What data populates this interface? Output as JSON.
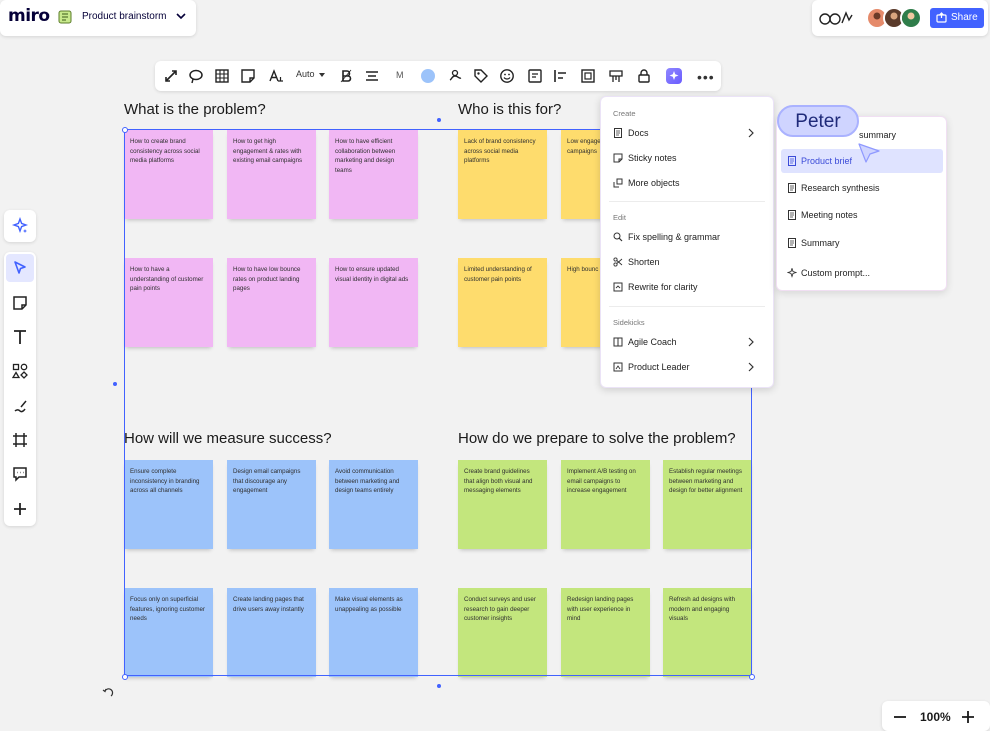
{
  "app": {
    "logo_text": "miro",
    "board_name": "Product brainstorm"
  },
  "header_right": {
    "share_label": "Share",
    "avatar_colors": [
      "#e58a6a",
      "#5a3a2a",
      "#2f7d4a"
    ]
  },
  "context_toolbar": {
    "font_size_label": "Auto",
    "size_label": "M",
    "selected_color": "#9cc3fa",
    "icons": [
      "connection-line-icon",
      "lasso-icon",
      "table-icon",
      "sticky-note-icon",
      "text-format-icon",
      "bold-icon",
      "align-center-icon",
      "fill-color-icon",
      "brush-icon",
      "tag-icon",
      "emoji-icon",
      "card-icon",
      "align-left-icon",
      "frame-icon",
      "grid-icon",
      "lock-icon",
      "ai-sparkle-icon",
      "more-icon"
    ]
  },
  "left_toolbar": {
    "tools": [
      "ai-sparkle-icon",
      "select-cursor-icon",
      "sticky-note-icon",
      "text-icon",
      "shapes-icon",
      "pen-icon",
      "frame-icon",
      "comment-icon",
      "add-icon"
    ]
  },
  "board": {
    "sections": [
      {
        "title": "What is the problem?",
        "color": "pink",
        "notes": [
          "How to create brand consistency across social media platforms",
          "How to get high engagement & rates with existing email campaigns",
          "How to have efficient collaboration between marketing and design teams",
          "How to have a understanding of customer pain points",
          "How to have low bounce rates on product landing pages",
          "How to ensure updated visual identity in digital ads"
        ]
      },
      {
        "title": "Who is this for?",
        "color": "yellow",
        "notes": [
          "Lack of brand consistency across social media platforms",
          "Low engage with existi campaigns",
          "Limited understanding of customer pain points",
          "High bounc product lan"
        ]
      },
      {
        "title": "How will we measure success?",
        "color": "blue",
        "notes": [
          "Ensure complete inconsistency in branding across all channels",
          "Design email campaigns that discourage any engagement",
          "Avoid communication between marketing and design teams entirely",
          "Focus only on superficial features, ignoring customer needs",
          "Create landing pages that drive users away instantly",
          "Make visual elements as unappealing as possible"
        ]
      },
      {
        "title": "How do we prepare to solve the problem?",
        "color": "green",
        "notes": [
          "Create brand guidelines that align both visual and messaging elements",
          "Implement A/B testing on email campaigns to increase engagement",
          "Establish regular meetings between marketing and design for better alignment",
          "Conduct surveys and user research to gain deeper customer insights",
          "Redesign landing pages with user experience in mind",
          "Refresh ad designs with modern and engaging visuals"
        ]
      }
    ]
  },
  "ai_menu": {
    "create_header": "Create",
    "create_items": [
      {
        "label": "Docs",
        "icon": "doc-icon",
        "submenu": true
      },
      {
        "label": "Sticky notes",
        "icon": "sticky-note-icon",
        "submenu": false
      },
      {
        "label": "More objects",
        "icon": "more-objects-icon",
        "submenu": false
      }
    ],
    "edit_header": "Edit",
    "edit_items": [
      {
        "label": "Fix spelling & grammar",
        "icon": "spellcheck-icon"
      },
      {
        "label": "Shorten",
        "icon": "scissors-icon"
      },
      {
        "label": "Rewrite for clarity",
        "icon": "rewrite-icon"
      }
    ],
    "sidekicks_header": "Sidekicks",
    "sidekick_items": [
      {
        "label": "Agile Coach",
        "icon": "agile-coach-icon",
        "submenu": true
      },
      {
        "label": "Product Leader",
        "icon": "product-leader-icon",
        "submenu": true
      }
    ]
  },
  "docs_submenu": {
    "items": [
      {
        "label": "summary",
        "active": false
      },
      {
        "label": "Product brief",
        "active": true
      },
      {
        "label": "Research synthesis",
        "active": false
      },
      {
        "label": "Meeting notes",
        "active": false
      },
      {
        "label": "Summary",
        "active": false
      },
      {
        "label": "Custom prompt...",
        "active": false
      }
    ]
  },
  "cursor": {
    "user_name": "Peter"
  },
  "zoom": {
    "level": "100%"
  }
}
